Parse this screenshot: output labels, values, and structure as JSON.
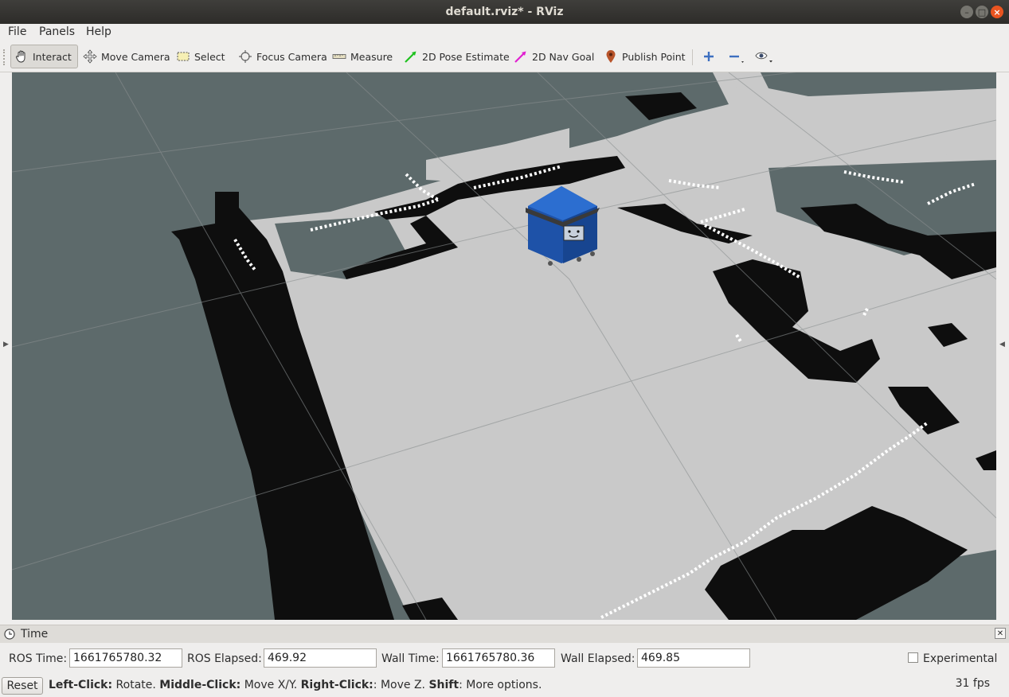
{
  "window": {
    "title": "default.rviz* - RViz"
  },
  "menu": {
    "file": "File",
    "panels": "Panels",
    "help": "Help"
  },
  "toolbar": {
    "interact": "Interact",
    "move_camera": "Move Camera",
    "select": "Select",
    "focus_camera": "Focus Camera",
    "measure": "Measure",
    "pose_estimate": "2D Pose Estimate",
    "nav_goal": "2D Nav Goal",
    "publish_point": "Publish Point",
    "icons": [
      "hand-icon",
      "move-camera-icon",
      "select-icon",
      "focus-camera-icon",
      "measure-icon",
      "pose-arrow-icon",
      "goal-arrow-icon",
      "map-pin-icon",
      "plus-icon",
      "minus-icon",
      "eye-icon"
    ]
  },
  "time_panel": {
    "title": "Time",
    "ros_time_label": "ROS Time:",
    "ros_time": "1661765780.32",
    "ros_elapsed_label": "ROS Elapsed:",
    "ros_elapsed": "469.92",
    "wall_time_label": "Wall Time:",
    "wall_time": "1661765780.36",
    "wall_elapsed_label": "Wall Elapsed:",
    "wall_elapsed": "469.85",
    "experimental_label": "Experimental",
    "experimental_checked": false
  },
  "status": {
    "reset": "Reset",
    "hint_left_key": "Left-Click:",
    "hint_left_val": " Rotate. ",
    "hint_middle_key": "Middle-Click:",
    "hint_middle_val": " Move X/Y. ",
    "hint_right_key": "Right-Click:",
    "hint_right_val": ": Move Z. ",
    "hint_shift_key": "Shift",
    "hint_shift_val": ": More options.",
    "fps": "31 fps"
  },
  "colors": {
    "accent_orange": "#e95420",
    "map_free": "#c9c9c9",
    "map_unknown": "#5d6a6b",
    "map_occupied": "#0e0e0e",
    "robot_blue": "#1f5fbf"
  }
}
